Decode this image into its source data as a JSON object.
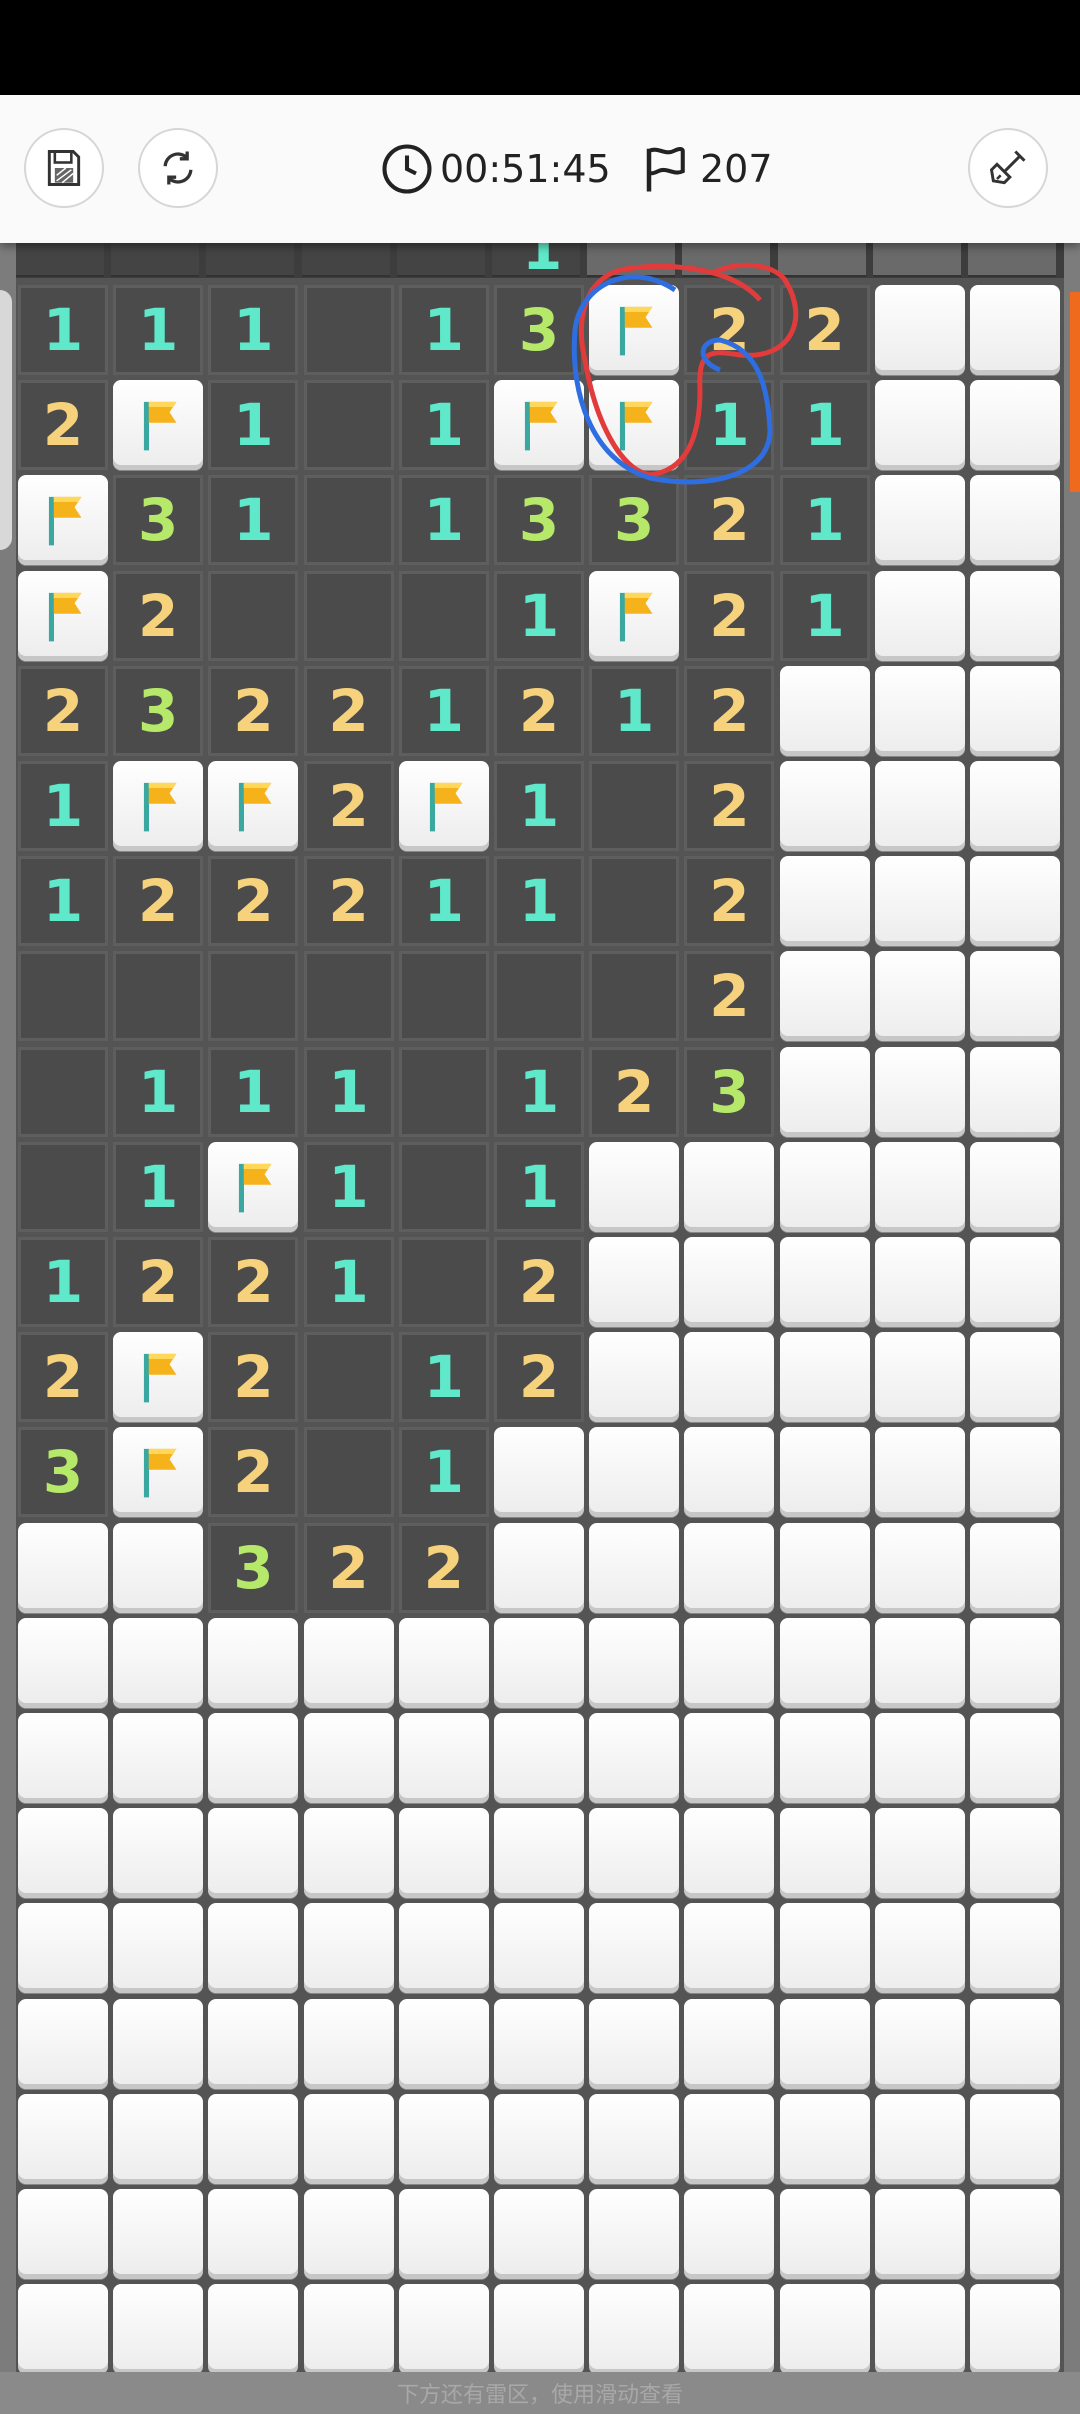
{
  "toolbar": {
    "save_icon": "save-icon",
    "restart_icon": "restart-icon",
    "timer_icon": "clock-icon",
    "timer": "00:51:45",
    "flag_icon": "flag-outline-icon",
    "flags_count": "207",
    "shovel_icon": "shovel-icon"
  },
  "board": {
    "columns": 11,
    "rows": [
      [
        "1",
        "1",
        "1",
        "_",
        "1",
        "3",
        "F",
        "2",
        "2",
        "C",
        "C"
      ],
      [
        "2",
        "F",
        "1",
        "_",
        "1",
        "F",
        "F",
        "1",
        "1",
        "C",
        "C"
      ],
      [
        "F",
        "3",
        "1",
        "_",
        "1",
        "3",
        "3",
        "2",
        "1",
        "C",
        "C"
      ],
      [
        "F",
        "2",
        "_",
        "_",
        "_",
        "1",
        "F",
        "2",
        "1",
        "C",
        "C"
      ],
      [
        "2",
        "3",
        "2",
        "2",
        "1",
        "2",
        "1",
        "2",
        "C",
        "C",
        "C"
      ],
      [
        "1",
        "F",
        "F",
        "2",
        "F",
        "1",
        "_",
        "2",
        "C",
        "C",
        "C"
      ],
      [
        "1",
        "2",
        "2",
        "2",
        "1",
        "1",
        "_",
        "2",
        "C",
        "C",
        "C"
      ],
      [
        "_",
        "_",
        "_",
        "_",
        "_",
        "_",
        "_",
        "2",
        "C",
        "C",
        "C"
      ],
      [
        "_",
        "1",
        "1",
        "1",
        "_",
        "1",
        "2",
        "3",
        "C",
        "C",
        "C"
      ],
      [
        "_",
        "1",
        "F",
        "1",
        "_",
        "1",
        "C",
        "C",
        "C",
        "C",
        "C"
      ],
      [
        "1",
        "2",
        "2",
        "1",
        "_",
        "2",
        "C",
        "C",
        "C",
        "C",
        "C"
      ],
      [
        "2",
        "F",
        "2",
        "_",
        "1",
        "2",
        "C",
        "C",
        "C",
        "C",
        "C"
      ],
      [
        "3",
        "F",
        "2",
        "_",
        "1",
        "C",
        "C",
        "C",
        "C",
        "C",
        "C"
      ],
      [
        "C",
        "C",
        "3",
        "2",
        "2",
        "C",
        "C",
        "C",
        "C",
        "C",
        "C"
      ],
      [
        "C",
        "C",
        "C",
        "C",
        "C",
        "C",
        "C",
        "C",
        "C",
        "C",
        "C"
      ],
      [
        "C",
        "C",
        "C",
        "C",
        "C",
        "C",
        "C",
        "C",
        "C",
        "C",
        "C"
      ],
      [
        "C",
        "C",
        "C",
        "C",
        "C",
        "C",
        "C",
        "C",
        "C",
        "C",
        "C"
      ],
      [
        "C",
        "C",
        "C",
        "C",
        "C",
        "C",
        "C",
        "C",
        "C",
        "C",
        "C"
      ],
      [
        "C",
        "C",
        "C",
        "C",
        "C",
        "C",
        "C",
        "C",
        "C",
        "C",
        "C"
      ],
      [
        "C",
        "C",
        "C",
        "C",
        "C",
        "C",
        "C",
        "C",
        "C",
        "C",
        "C"
      ],
      [
        "C",
        "C",
        "C",
        "C",
        "C",
        "C",
        "C",
        "C",
        "C",
        "C",
        "C"
      ],
      [
        "C",
        "C",
        "C",
        "C",
        "C",
        "C",
        "C",
        "C",
        "C",
        "C",
        "C"
      ]
    ],
    "top_strip": [
      "R",
      "R",
      "R",
      "R",
      "R",
      "R",
      "C",
      "C",
      "C",
      "C",
      "C"
    ],
    "top_strip_partial_number": "1",
    "number_colors": {
      "1": "#5fe8c9",
      "2": "#f6d27c",
      "3": "#b6e86a"
    },
    "flag_color": "#f6b21b"
  },
  "annotation_colors": {
    "red": "#e23b3b",
    "blue": "#2f6ee0"
  },
  "hint": "下方还有雷区，使用滑动查看"
}
